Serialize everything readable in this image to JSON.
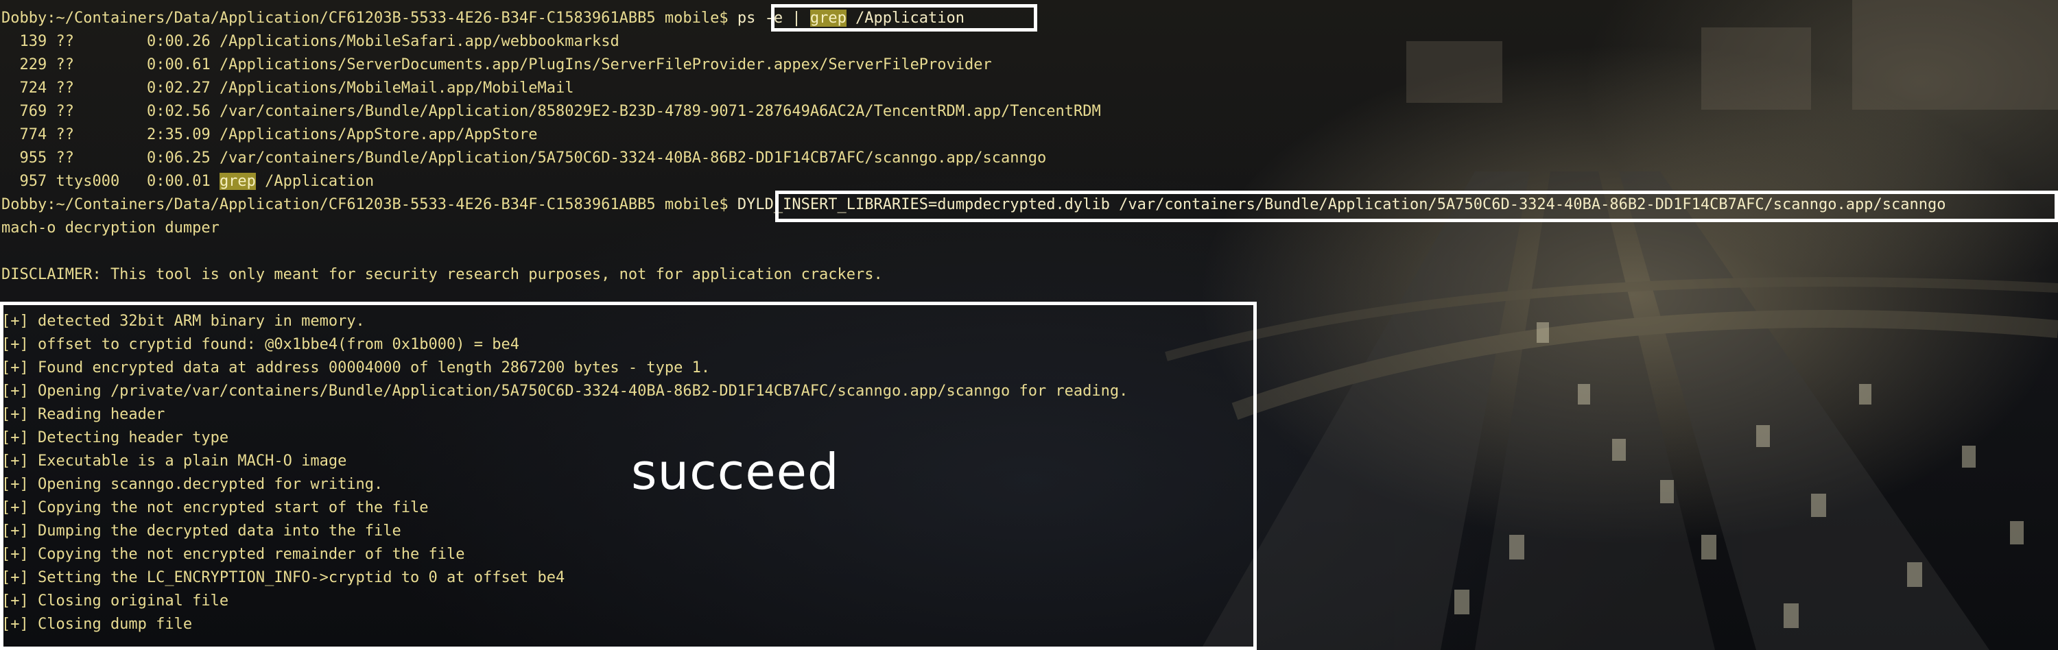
{
  "prompt": "Dobby:~/Containers/Data/Application/CF61203B-5533-4E26-B34F-C1583961ABB5 mobile$",
  "command1": {
    "part_a": "ps -e | ",
    "highlight": "grep",
    "part_b": " /Application"
  },
  "processes": [
    {
      "pid": "139",
      "tty": "??",
      "time": "0:00.26",
      "cmd": "/Applications/MobileSafari.app/webbookmarksd"
    },
    {
      "pid": "229",
      "tty": "??",
      "time": "0:00.61",
      "cmd": "/Applications/ServerDocuments.app/PlugIns/ServerFileProvider.appex/ServerFileProvider"
    },
    {
      "pid": "724",
      "tty": "??",
      "time": "0:02.27",
      "cmd": "/Applications/MobileMail.app/MobileMail"
    },
    {
      "pid": "769",
      "tty": "??",
      "time": "0:02.56",
      "cmd": "/var/containers/Bundle/Application/858029E2-B23D-4789-9071-287649A6AC2A/TencentRDM.app/TencentRDM"
    },
    {
      "pid": "774",
      "tty": "??",
      "time": "2:35.09",
      "cmd": "/Applications/AppStore.app/AppStore"
    },
    {
      "pid": "955",
      "tty": "??",
      "time": "0:06.25",
      "cmd": "/var/containers/Bundle/Application/5A750C6D-3324-40BA-86B2-DD1F14CB7AFC/scanngo.app/scanngo"
    }
  ],
  "grep_process": {
    "pid": "957",
    "tty": "ttys000",
    "time": "0:00.01",
    "highlight": "grep",
    "cmd_rest": " /Application"
  },
  "command2": "DYLD_INSERT_LIBRARIES=dumpdecrypted.dylib /var/containers/Bundle/Application/5A750C6D-3324-40BA-86B2-DD1F14CB7AFC/scanngo.app/scanngo",
  "output_header": "mach-o decryption dumper",
  "disclaimer": "DISCLAIMER: This tool is only meant for security research purposes, not for application crackers.",
  "log_lines": [
    "[+] detected 32bit ARM binary in memory.",
    "[+] offset to cryptid found: @0x1bbe4(from 0x1b000) = be4",
    "[+] Found encrypted data at address 00004000 of length 2867200 bytes - type 1.",
    "[+] Opening /private/var/containers/Bundle/Application/5A750C6D-3324-40BA-86B2-DD1F14CB7AFC/scanngo.app/scanngo for reading.",
    "[+] Reading header",
    "[+] Detecting header type",
    "[+] Executable is a plain MACH-O image",
    "[+] Opening scanngo.decrypted for writing.",
    "[+] Copying the not encrypted start of the file",
    "[+] Dumping the decrypted data into the file",
    "[+] Copying the not encrypted remainder of the file",
    "[+] Setting the LC_ENCRYPTION_INFO->cryptid to 0 at offset be4",
    "[+] Closing original file",
    "[+] Closing dump file"
  ],
  "annotation": "succeed",
  "colors": {
    "terminal_text": "#e9dc92",
    "grep_highlight": "#9a8f2a",
    "annotation_box": "#ffffff"
  }
}
